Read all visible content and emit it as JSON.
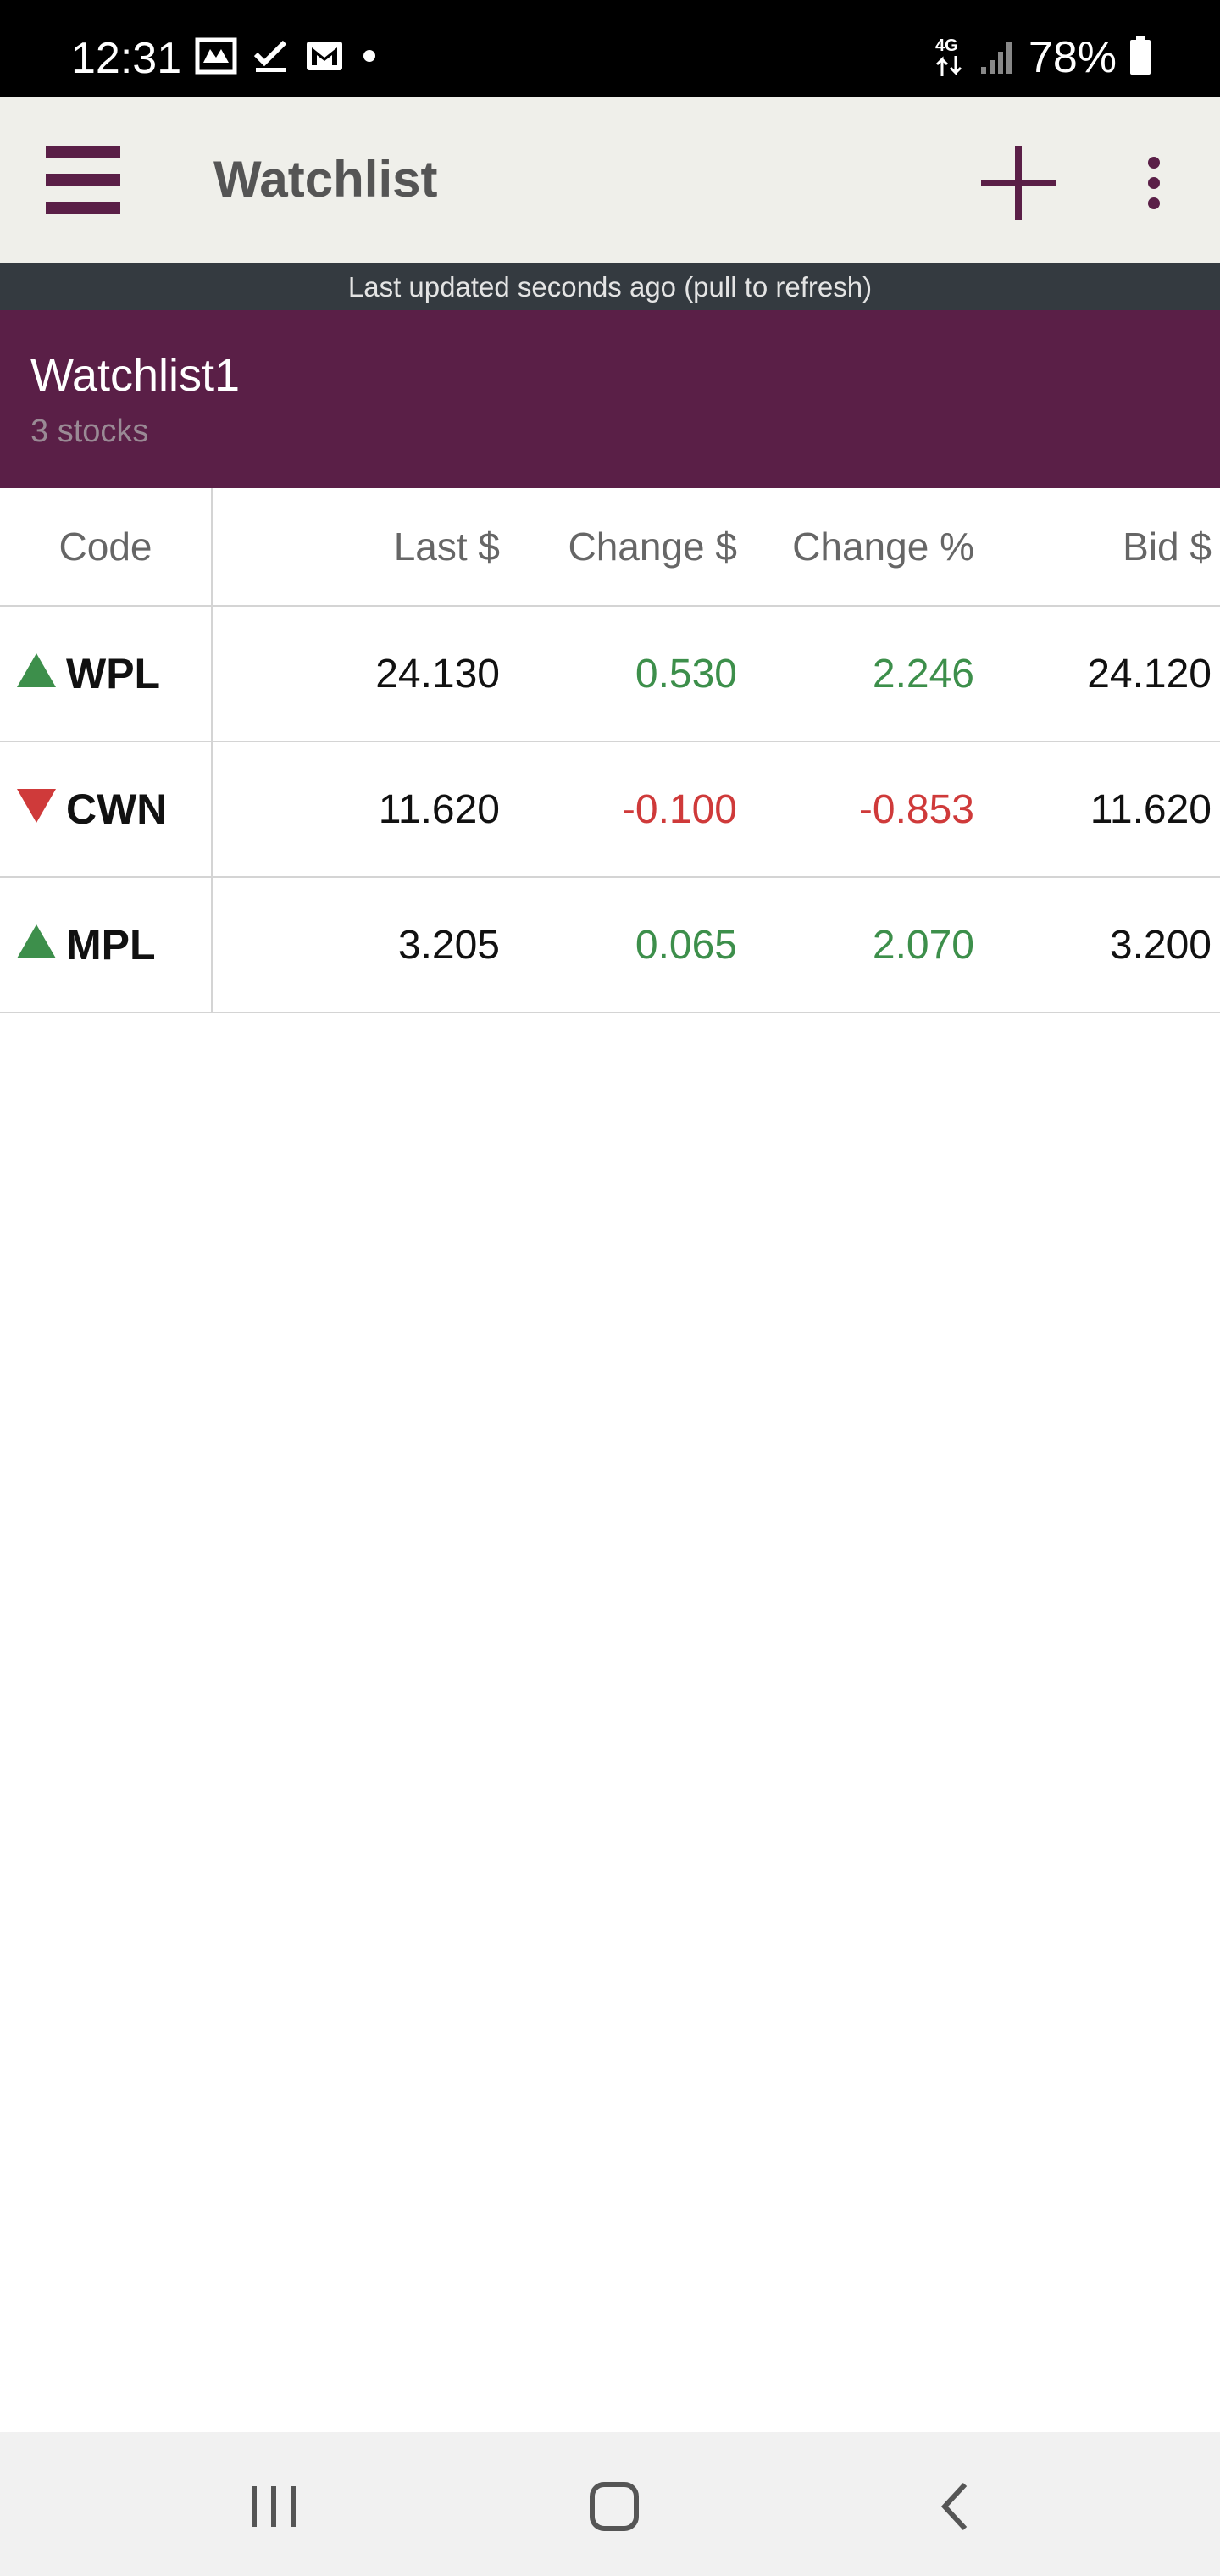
{
  "status_bar": {
    "time": "12:31",
    "network_label": "4G",
    "battery": "78%",
    "icons": [
      "gallery-icon",
      "check-icon",
      "gmail-icon",
      "dot-icon",
      "network-4g-icon",
      "signal-icon",
      "battery-icon"
    ]
  },
  "app_bar": {
    "title": "Watchlist",
    "icons": [
      "menu-icon",
      "plus-icon",
      "more-vert-icon"
    ],
    "accent_color": "#5a1f47"
  },
  "banner": {
    "text": "Last updated seconds ago (pull to refresh)"
  },
  "watchlist": {
    "name": "Watchlist1",
    "count_text": "3 stocks"
  },
  "table": {
    "headers": {
      "code": "Code",
      "last": "Last $",
      "change": "Change $",
      "change_pct": "Change %",
      "bid": "Bid $"
    },
    "rows": [
      {
        "direction": "up",
        "code": "WPL",
        "last": "24.130",
        "change": "0.530",
        "change_pct": "2.246",
        "bid": "24.120"
      },
      {
        "direction": "down",
        "code": "CWN",
        "last": "11.620",
        "change": "-0.100",
        "change_pct": "-0.853",
        "bid": "11.620"
      },
      {
        "direction": "up",
        "code": "MPL",
        "last": "3.205",
        "change": "0.065",
        "change_pct": "2.070",
        "bid": "3.200"
      }
    ],
    "colors": {
      "positive": "#3d8f4b",
      "negative": "#cf3a3a"
    }
  },
  "nav_bar": {
    "icons": [
      "recent-apps-icon",
      "home-icon",
      "back-icon"
    ]
  }
}
